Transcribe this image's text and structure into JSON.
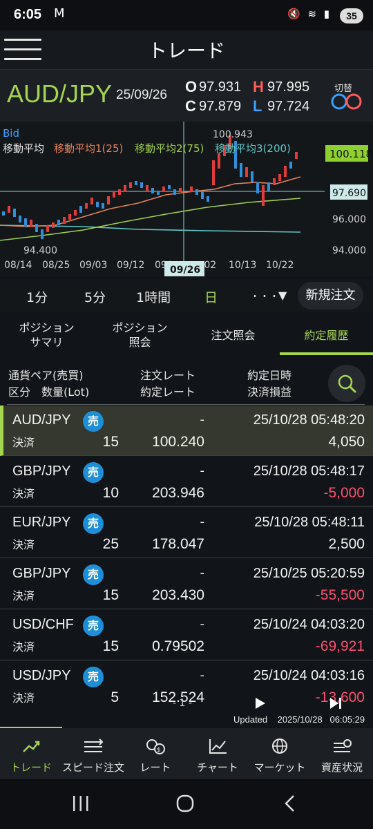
{
  "status_bar": {
    "time": "6:05",
    "mail_icon": "M",
    "icons_text": "🔇 ≋ ▮",
    "battery": "35"
  },
  "header": {
    "title": "トレード",
    "menu_icon": "hamburger-icon"
  },
  "quote": {
    "pair": "AUD/JPY",
    "date": "25/09/26",
    "open_label": "O",
    "open": "97.931",
    "high_label": "H",
    "high": "97.995",
    "close_label": "C",
    "close": "97.879",
    "low_label": "L",
    "low": "97.724",
    "switch_label": "切替",
    "colors": {
      "pair": "#a5d64f",
      "high": "#ff5a5a",
      "low": "#3aa0ff"
    }
  },
  "chart": {
    "bid_label": "Bid",
    "ma_label": "移動平均",
    "ma1_label": "移動平均1(25)",
    "ma2_label": "移動平均2(75)",
    "ma3_label": "移動平均3(200)",
    "high_annotation": "100.943",
    "low_annotation": "94.400",
    "current_price": "100.118",
    "crosshair_price": "97.690",
    "y_ticks": [
      "96.000",
      "94.000"
    ],
    "x_ticks": [
      "08/14",
      "08/25",
      "09/03",
      "09/12",
      "09/...",
      "...02",
      "10/13",
      "10/22"
    ],
    "crosshair_date": "09/26",
    "colors": {
      "bull": "#e03c3c",
      "bear": "#2f8fd8",
      "ma1": "#e8825a",
      "ma2": "#9ed04a",
      "ma3": "#5fc7c7"
    }
  },
  "timeframes": {
    "items": [
      "1分",
      "5分",
      "1時間",
      "日"
    ],
    "selected": "日",
    "more": "・・・",
    "dropdown": "▼",
    "new_order": "新規注文"
  },
  "tabs": {
    "items": [
      "ポジション\nサマリ",
      "ポジション\n照会",
      "注文照会",
      "約定履歴"
    ],
    "selected_index": 3
  },
  "list_header": {
    "col1_line1": "通貨ペア(売買)",
    "col1_line2": "区分　数量(Lot)",
    "col2_line1": "注文レート",
    "col2_line2": "約定レート",
    "col3_line1": "約定日時",
    "col3_line2": "決済損益"
  },
  "rows": [
    {
      "pair": "AUD/JPY",
      "side": "売",
      "type": "決済",
      "qty": "15",
      "order_rate": "-",
      "exec_rate": "100.240",
      "datetime": "25/10/28 05:48:20",
      "pnl": "4,050",
      "pnl_color": "#f4f4f4"
    },
    {
      "pair": "GBP/JPY",
      "side": "売",
      "type": "決済",
      "qty": "10",
      "order_rate": "-",
      "exec_rate": "203.946",
      "datetime": "25/10/28 05:48:17",
      "pnl": "-5,000",
      "pnl_color": "#ff4d6d"
    },
    {
      "pair": "EUR/JPY",
      "side": "売",
      "type": "決済",
      "qty": "25",
      "order_rate": "-",
      "exec_rate": "178.047",
      "datetime": "25/10/28 05:48:11",
      "pnl": "2,500",
      "pnl_color": "#f4f4f4"
    },
    {
      "pair": "GBP/JPY",
      "side": "売",
      "type": "決済",
      "qty": "15",
      "order_rate": "-",
      "exec_rate": "203.430",
      "datetime": "25/10/25 05:20:59",
      "pnl": "-55,500",
      "pnl_color": "#ff4d6d"
    },
    {
      "pair": "USD/CHF",
      "side": "売",
      "type": "決済",
      "qty": "15",
      "order_rate": "-",
      "exec_rate": "0.79502",
      "datetime": "25/10/24 04:03:20",
      "pnl": "-69,921",
      "pnl_color": "#ff4d6d"
    },
    {
      "pair": "USD/JPY",
      "side": "売",
      "type": "決済",
      "qty": "5",
      "order_rate": "-",
      "exec_rate": "152.524",
      "datetime": "25/10/24 04:03:16",
      "pnl": "-13,600",
      "pnl_color": "#ff4d6d"
    }
  ],
  "pager": {
    "page": "- 1 -",
    "updated_label": "Updated",
    "updated_date": "2025/10/28",
    "updated_time": "06:05:29"
  },
  "bottom_nav": {
    "items": [
      {
        "label": "トレード",
        "icon": "trend-icon",
        "active": true
      },
      {
        "label": "スピード注文",
        "icon": "speed-order-icon",
        "active": false
      },
      {
        "label": "レート",
        "icon": "currency-icon",
        "active": false
      },
      {
        "label": "チャート",
        "icon": "chart-icon",
        "active": false
      },
      {
        "label": "マーケット",
        "icon": "globe-icon",
        "active": false
      },
      {
        "label": "資産状況",
        "icon": "assets-icon",
        "active": false
      }
    ],
    "active_color": "#a5d64f"
  }
}
